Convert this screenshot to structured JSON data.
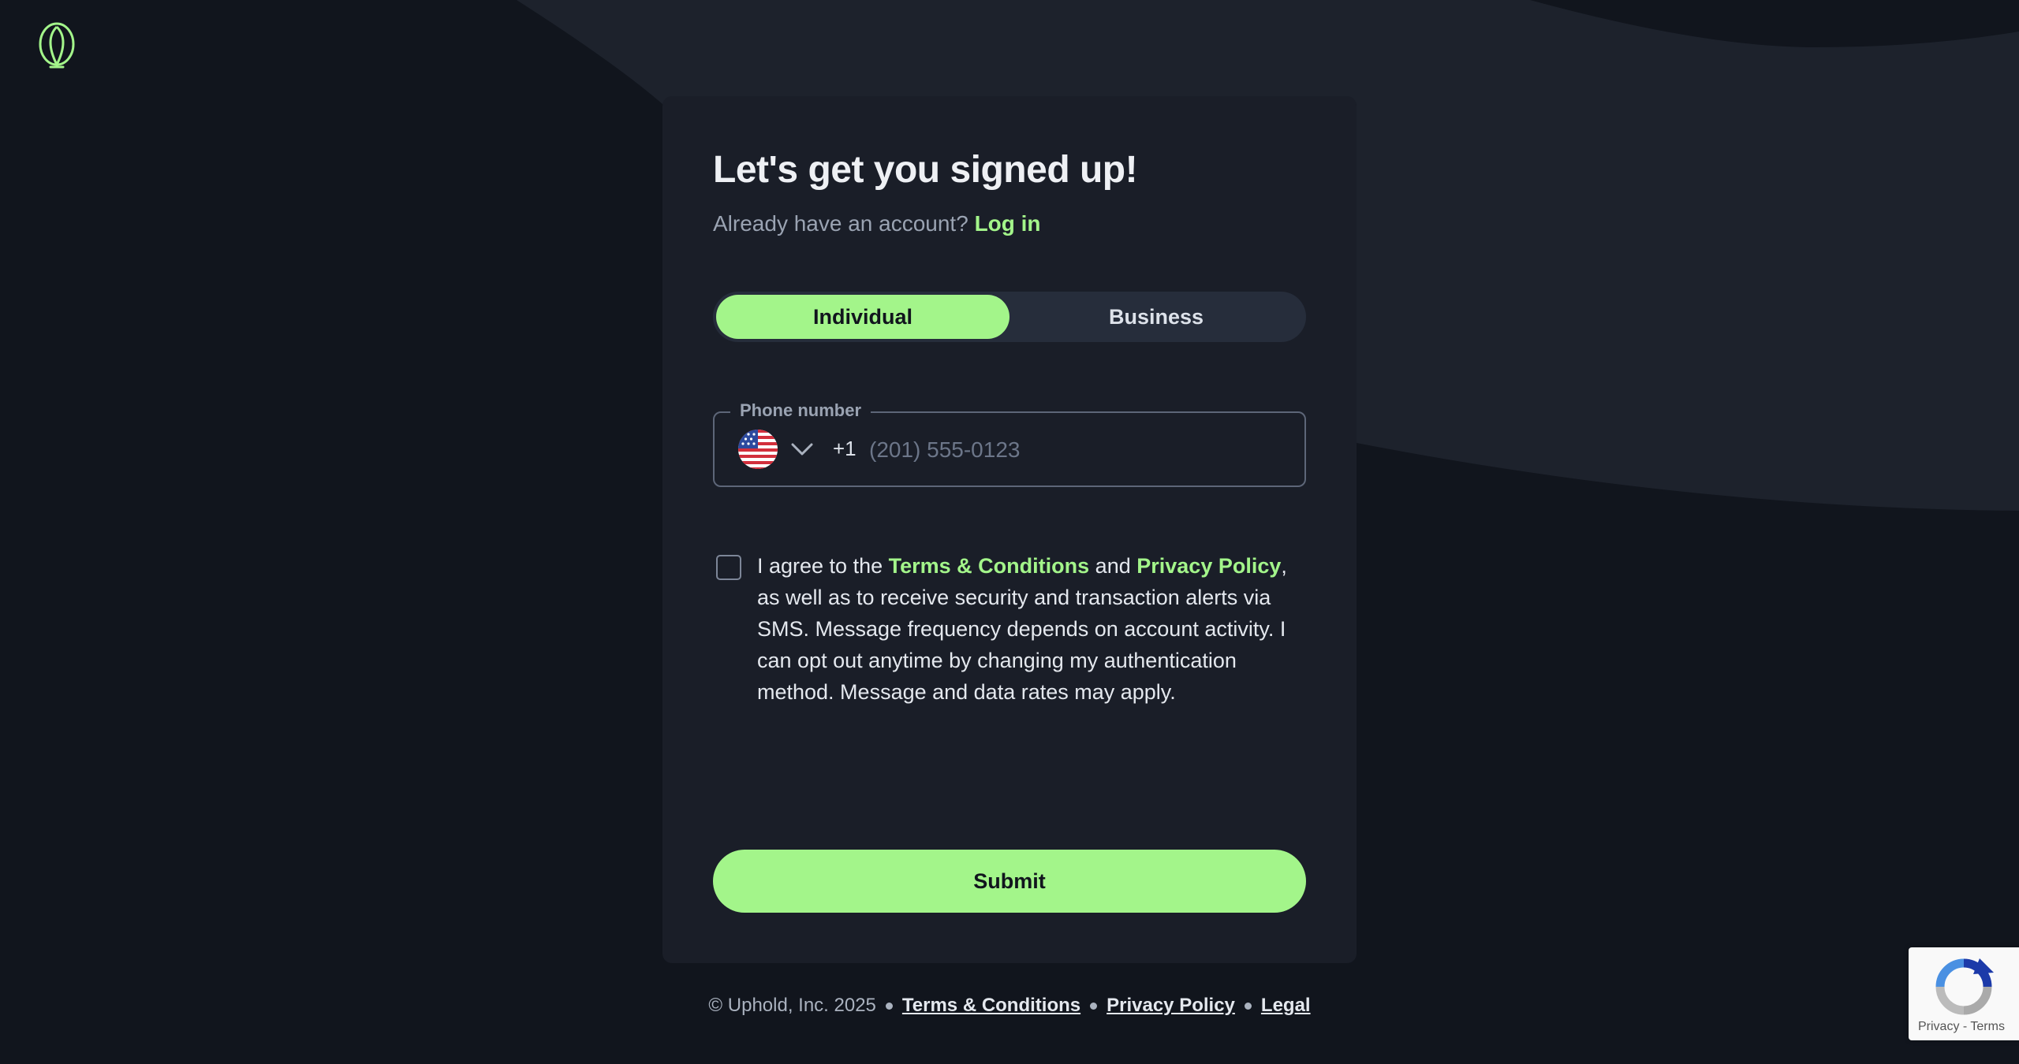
{
  "brand": {
    "logo_icon": "uphold-logo-icon",
    "accent_color": "#a3f58a",
    "background_color": "#11151d",
    "card_color": "#1a1e28"
  },
  "signup": {
    "title": "Let's get you signed up!",
    "account_prompt": "Already have an account?",
    "login_link": "Log in",
    "account_types": [
      {
        "label": "Individual",
        "selected": true
      },
      {
        "label": "Business",
        "selected": false
      }
    ],
    "phone": {
      "label": "Phone number",
      "country_flag_icon": "us-flag-icon",
      "dial_code": "+1",
      "placeholder": "(201) 555-0123",
      "value": ""
    },
    "consent": {
      "checked": false,
      "prefix": "I agree to the",
      "terms_link": "Terms & Conditions",
      "and": "and",
      "privacy_link": "Privacy Policy",
      "suffix": ", as well as to receive security and transaction alerts via SMS. Message frequency depends on account activity. I can opt out anytime by changing my authentication method. Message and data rates may apply."
    },
    "submit_label": "Submit"
  },
  "footer": {
    "copyright": "© Uphold, Inc. 2025",
    "links": [
      "Terms & Conditions",
      "Privacy Policy",
      "Legal"
    ]
  },
  "recaptcha": {
    "links": "Privacy - Terms"
  }
}
